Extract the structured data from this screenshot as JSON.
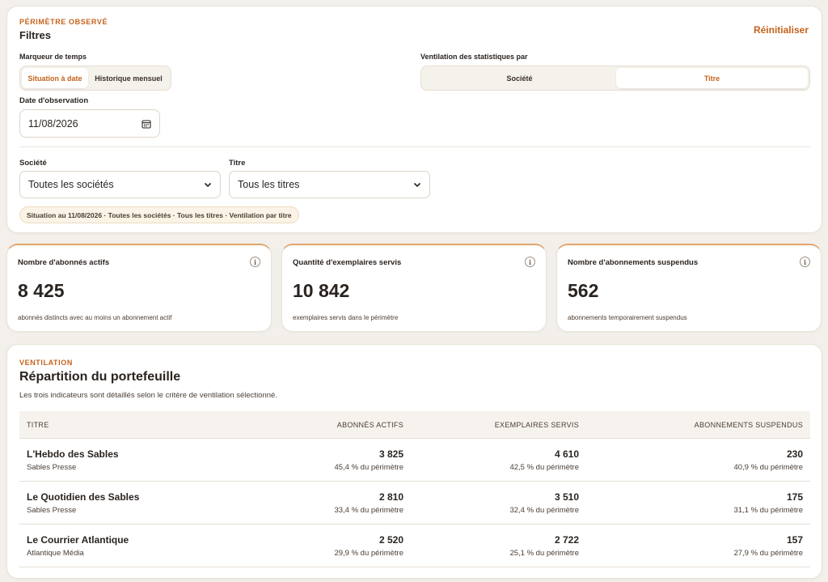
{
  "filters": {
    "eyebrow": "PÉRIMÈTRE OBSERVÉ",
    "title": "Filtres",
    "reset_label": "Réinitialiser",
    "time_marker": {
      "label": "Marqueur de temps",
      "options": [
        "Situation à date",
        "Historique mensuel"
      ],
      "selected": "Situation à date"
    },
    "breakdown_by": {
      "label": "Ventilation des statistiques par",
      "options": [
        "Société",
        "Titre"
      ],
      "selected": "Titre"
    },
    "observation_date": {
      "label": "Date d'observation",
      "value": "11/08/2026",
      "icon": "calendar-icon"
    },
    "company": {
      "label": "Société",
      "value": "Toutes les sociétés"
    },
    "title_filter": {
      "label": "Titre",
      "value": "Tous les titres"
    },
    "summary": "Situation au 11/08/2026 · Toutes les sociétés · Tous les titres · Ventilation par titre"
  },
  "kpis": [
    {
      "title": "Nombre d'abonnés actifs",
      "value": "8 425",
      "subtitle": "abonnés distincts avec au moins un abonnement actif",
      "info": "i"
    },
    {
      "title": "Quantité d'exemplaires servis",
      "value": "10 842",
      "subtitle": "exemplaires servis dans le périmètre",
      "info": "i"
    },
    {
      "title": "Nombre d'abonnements suspendus",
      "value": "562",
      "subtitle": "abonnements temporairement suspendus",
      "info": "i"
    }
  ],
  "breakdown": {
    "eyebrow": "VENTILATION",
    "title": "Répartition du portefeuille",
    "description": "Les trois indicateurs sont détaillés selon le critère de ventilation sélectionné.",
    "columns": [
      "TITRE",
      "ABONNÉS ACTIFS",
      "EXEMPLAIRES SERVIS",
      "ABONNEMENTS SUSPENDUS"
    ],
    "rows": [
      {
        "name": "L'Hebdo des Sables",
        "company": "Sables Presse",
        "active": "3 825",
        "active_pct": "45,4 % du périmètre",
        "copies": "4 610",
        "copies_pct": "42,5 % du périmètre",
        "suspended": "230",
        "suspended_pct": "40,9 % du périmètre"
      },
      {
        "name": "Le Quotidien des Sables",
        "company": "Sables Presse",
        "active": "2 810",
        "active_pct": "33,4 % du périmètre",
        "copies": "3 510",
        "copies_pct": "32,4 % du périmètre",
        "suspended": "175",
        "suspended_pct": "31,1 % du périmètre"
      },
      {
        "name": "Le Courrier Atlantique",
        "company": "Atlantique Média",
        "active": "2 520",
        "active_pct": "29,9 % du périmètre",
        "copies": "2 722",
        "copies_pct": "25,1 % du périmètre",
        "suspended": "157",
        "suspended_pct": "27,9 % du périmètre"
      }
    ]
  },
  "colors": {
    "accent": "#c5621c",
    "background": "#f3f0eb",
    "card": "#ffffff"
  }
}
